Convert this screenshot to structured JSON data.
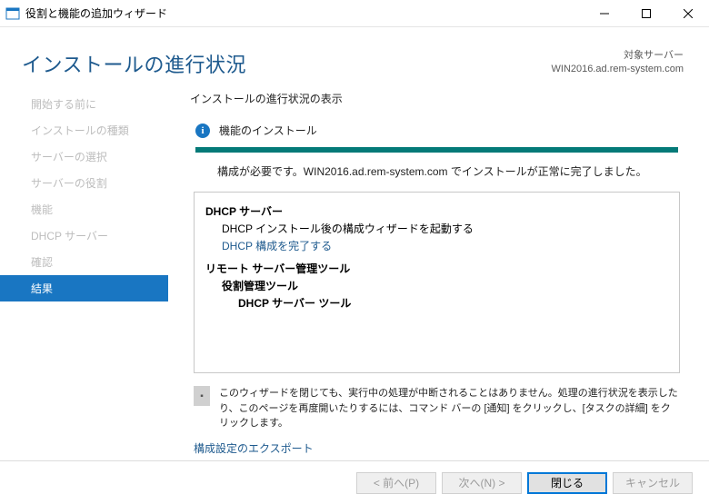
{
  "window": {
    "title": "役割と機能の追加ウィザード"
  },
  "header": {
    "title": "インストールの進行状況",
    "target_label": "対象サーバー",
    "target_server": "WIN2016.ad.rem-system.com"
  },
  "sidebar": {
    "items": [
      {
        "label": "開始する前に"
      },
      {
        "label": "インストールの種類"
      },
      {
        "label": "サーバーの選択"
      },
      {
        "label": "サーバーの役割"
      },
      {
        "label": "機能"
      },
      {
        "label": "DHCP サーバー"
      },
      {
        "label": "確認"
      },
      {
        "label": "結果"
      }
    ]
  },
  "main": {
    "subtitle": "インストールの進行状況の表示",
    "status": "機能のインストール",
    "done_message": "構成が必要です。WIN2016.ad.rem-system.com でインストールが正常に完了しました。",
    "results": {
      "r0": "DHCP サーバー",
      "r1": "DHCP インストール後の構成ウィザードを起動する",
      "r2": "DHCP 構成を完了する",
      "r3": "リモート サーバー管理ツール",
      "r4": "役割管理ツール",
      "r5": "DHCP サーバー ツール"
    },
    "note": "このウィザードを閉じても、実行中の処理が中断されることはありません。処理の進行状況を表示したり、このページを再度開いたりするには、コマンド バーの [通知] をクリックし、[タスクの詳細] をクリックします。",
    "export_link": "構成設定のエクスポート"
  },
  "footer": {
    "prev": "< 前へ(P)",
    "next": "次へ(N) >",
    "close": "閉じる",
    "cancel": "キャンセル"
  }
}
